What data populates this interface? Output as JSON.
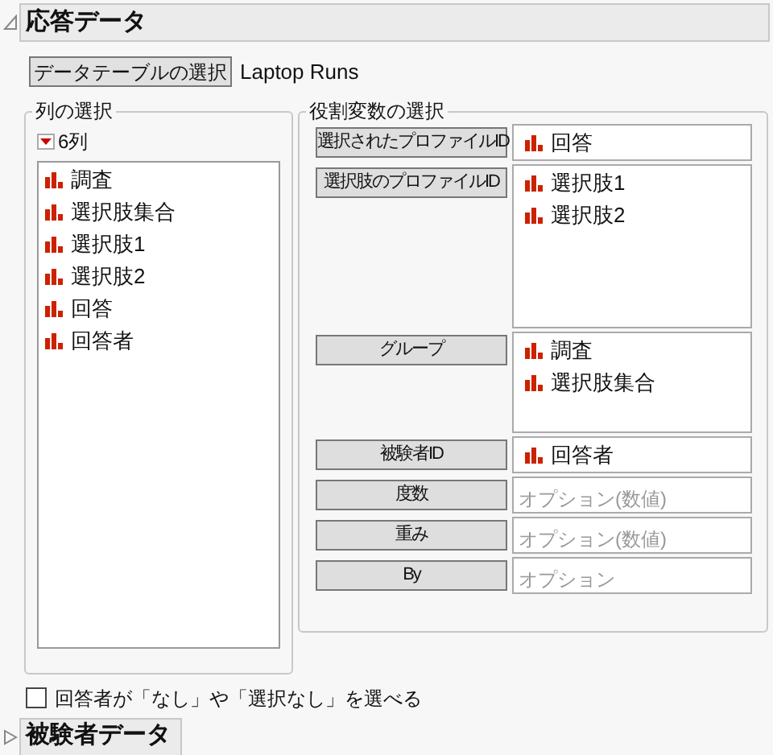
{
  "sections": [
    {
      "title": "応答データ",
      "expanded": true
    },
    {
      "title": "被験者データ",
      "expanded": false
    }
  ],
  "table_button": "データテーブルの選択",
  "table_name": "Laptop Runs",
  "columns_panel": {
    "legend": "列の選択",
    "count": "6列",
    "columns": [
      "調査",
      "選択肢集合",
      "選択肢1",
      "選択肢2",
      "回答",
      "回答者"
    ]
  },
  "roles_panel": {
    "legend": "役割変数の選択",
    "roles": [
      {
        "label": "選択されたプロファイルID",
        "items": [
          "回答"
        ]
      },
      {
        "label": "選択肢のプロファイルID",
        "items": [
          "選択肢1",
          "選択肢2"
        ]
      },
      {
        "label": "グループ",
        "items": [
          "調査",
          "選択肢集合"
        ]
      },
      {
        "label": "被験者ID",
        "items": [
          "回答者"
        ]
      },
      {
        "label": "度数",
        "placeholder": "オプション(数値)"
      },
      {
        "label": "重み",
        "placeholder": "オプション(数値)"
      },
      {
        "label": "By",
        "placeholder": "オプション"
      }
    ]
  },
  "none_option": {
    "label": "回答者が「なし」や「選択なし」を選べる",
    "checked": false
  }
}
